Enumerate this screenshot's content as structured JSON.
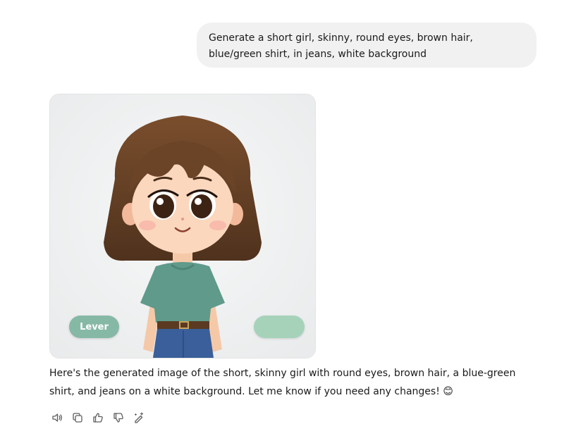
{
  "conversation": {
    "user_message": "Generate a short girl, skinny, round eyes, brown hair, blue/green shirt, in jeans, white background",
    "assistant_message": "Here's the generated image of the short, skinny girl with round eyes, brown hair, a blue-green shirt, and jeans on a white background. Let me know if you need any changes!",
    "assistant_emoji": "😊"
  },
  "generated_image": {
    "watermark_label": "Lever",
    "right_overlay_label": ""
  },
  "actions": [
    {
      "icon": "speaker-icon"
    },
    {
      "icon": "copy-icon"
    },
    {
      "icon": "thumbs-up-icon"
    },
    {
      "icon": "thumbs-down-icon"
    },
    {
      "icon": "edit-sparkle-icon"
    }
  ],
  "colors": {
    "user_bubble": "#f1f1f1",
    "hair": "#6b4428",
    "shirt": "#5f9a8a",
    "jeans": "#3a5f9a",
    "overlay_button": "#86b8a6"
  }
}
